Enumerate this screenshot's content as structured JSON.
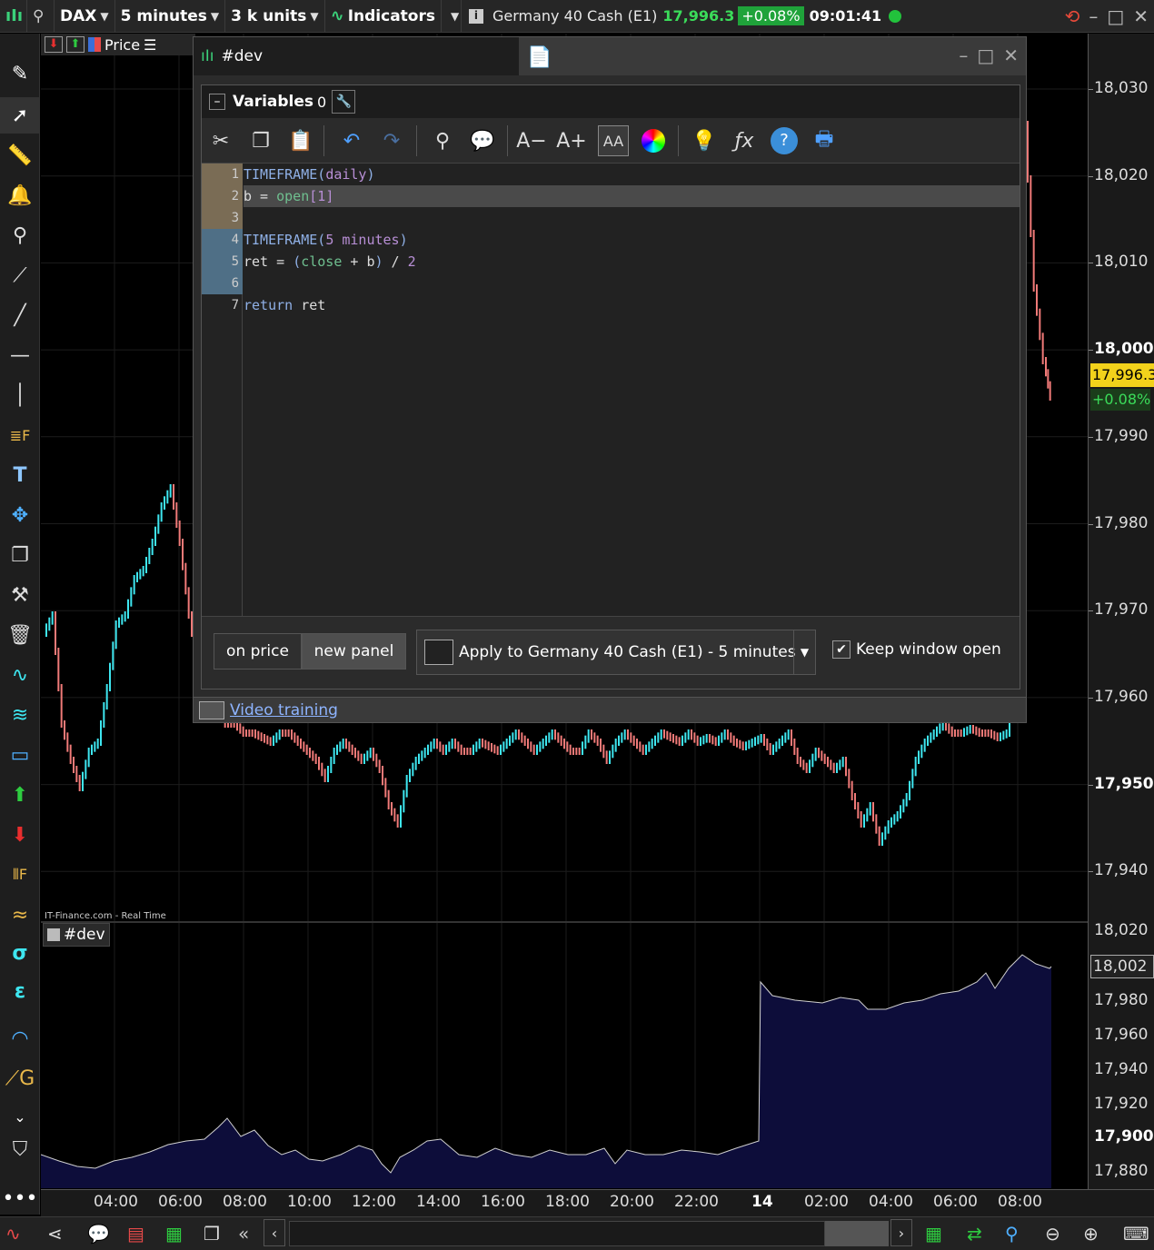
{
  "topbar": {
    "symbol": "DAX",
    "timeframe": "5 minutes",
    "units": "3 k units",
    "indicators_label": "Indicators",
    "instrument": "Germany 40 Cash (E1)",
    "price": "17,996.3",
    "change": "+0.08%",
    "time": "09:01:41"
  },
  "chart": {
    "subbar_label": "Price",
    "source": "IT-Finance.com - Real Time",
    "price_tag": "17,996.3",
    "change_tag": "+0.08%",
    "panel_name": "#dev",
    "panel_value_tag": "18,002",
    "top_axis": [
      "18,030",
      "18,020",
      "18,010",
      "18,000",
      "17,990",
      "17,980",
      "17,970",
      "17,960",
      "17,950",
      "17,940"
    ],
    "bottom_axis": [
      "18,020",
      "17,980",
      "17,960",
      "17,940",
      "17,920",
      "17,900",
      "17,880"
    ],
    "x_axis": [
      "04:00",
      "06:00",
      "08:00",
      "10:00",
      "12:00",
      "14:00",
      "16:00",
      "18:00",
      "20:00",
      "22:00",
      "14",
      "02:00",
      "04:00",
      "06:00",
      "08:00"
    ],
    "colors": {
      "up": "#3ee6f0",
      "down": "#f07a78",
      "area": "#0d0d3a",
      "line": "#cfcfcf"
    }
  },
  "dialog": {
    "title": "#dev",
    "variables_label": "Variables",
    "variables_count": "0",
    "code_lines": [
      {
        "num": "1",
        "text": "TIMEFRAME(daily)"
      },
      {
        "num": "2",
        "text": "b = open[1]"
      },
      {
        "num": "3",
        "text": ""
      },
      {
        "num": "4",
        "text": "TIMEFRAME(5 minutes)"
      },
      {
        "num": "5",
        "text": "ret = (close + b) / 2"
      },
      {
        "num": "6",
        "text": ""
      },
      {
        "num": "7",
        "text": "return ret"
      }
    ],
    "btn_on_price": "on price",
    "btn_new_panel": "new panel",
    "apply_label": "Apply to Germany 40 Cash (E1) - 5 minutes",
    "keep_open_label": "Keep window open",
    "video_link": "Video training"
  }
}
